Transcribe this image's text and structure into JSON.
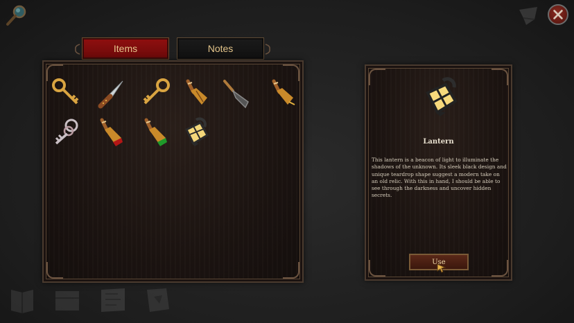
{
  "tabs": [
    {
      "label": "Items",
      "active": true
    },
    {
      "label": "Notes",
      "active": false
    }
  ],
  "inventory": [
    {
      "icon": "gold-key-icon"
    },
    {
      "icon": "knife-icon"
    },
    {
      "icon": "gold-key-icon"
    },
    {
      "icon": "broom-icon"
    },
    {
      "icon": "trowel-icon"
    },
    {
      "icon": "broom-icon"
    },
    {
      "icon": "skeleton-key-ring-icon"
    },
    {
      "icon": "red-brush-icon"
    },
    {
      "icon": "green-brush-icon"
    },
    {
      "icon": "lantern-icon",
      "selected": true
    }
  ],
  "selected_item": {
    "name": "Lantern",
    "icon": "lantern-icon",
    "description": "This lantern is a beacon of light to illuminate the shadows of the unknown. Its sleek black design and unique teardrop shape suggest a modern take on an old relic. With this in hand, I should be able to see through the darkness and uncover hidden secrets.",
    "action_label": "Use"
  },
  "toolbar": {
    "top_left": "magnifier-icon",
    "top_right": [
      "hat-icon",
      "close-icon"
    ],
    "bottom": [
      "journal-icon",
      "chest-icon",
      "map-icon",
      "book-icon"
    ]
  },
  "colors": {
    "tab_active": "#8e0f0f",
    "tab_text": "#e6c58c",
    "panel_border": "#4a3a2e",
    "close_red": "#8a2a1f"
  }
}
